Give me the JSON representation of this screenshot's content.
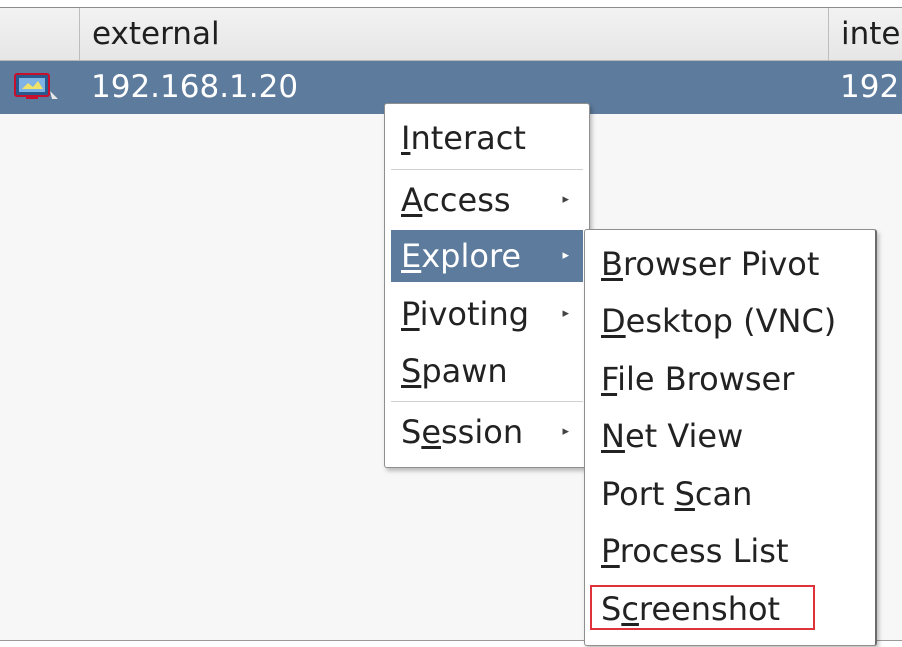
{
  "table": {
    "columns": [
      "",
      "external",
      "inte"
    ],
    "rows": [
      {
        "icon": "host-computer-icon",
        "external": "192.168.1.20",
        "internal": "192"
      }
    ]
  },
  "context_menu": {
    "items": [
      {
        "pre": "",
        "key": "I",
        "post": "nteract",
        "submenu": false
      },
      {
        "pre": "",
        "key": "A",
        "post": "ccess",
        "submenu": true
      },
      {
        "pre": "",
        "key": "E",
        "post": "xplore",
        "submenu": true,
        "active": true
      },
      {
        "pre": "",
        "key": "P",
        "post": "ivoting",
        "submenu": true
      },
      {
        "pre": "",
        "key": "S",
        "post": "pawn",
        "submenu": false
      },
      {
        "pre": "S",
        "key": "e",
        "post": "ssion",
        "submenu": true
      }
    ]
  },
  "explore_submenu": {
    "items": [
      {
        "pre": "",
        "key": "B",
        "post": "rowser Pivot"
      },
      {
        "pre": "",
        "key": "D",
        "post": "esktop (VNC)"
      },
      {
        "pre": "",
        "key": "F",
        "post": "ile Browser"
      },
      {
        "pre": "",
        "key": "N",
        "post": "et View"
      },
      {
        "pre": "Port ",
        "key": "S",
        "post": "can"
      },
      {
        "pre": "",
        "key": "P",
        "post": "rocess List"
      },
      {
        "pre": "S",
        "key": "c",
        "post": "reenshot",
        "highlighted": true
      }
    ]
  },
  "colors": {
    "selection": "#5d7b9d",
    "highlight_box": "#e0323a"
  },
  "icons": {
    "submenu_arrow": "▸"
  }
}
